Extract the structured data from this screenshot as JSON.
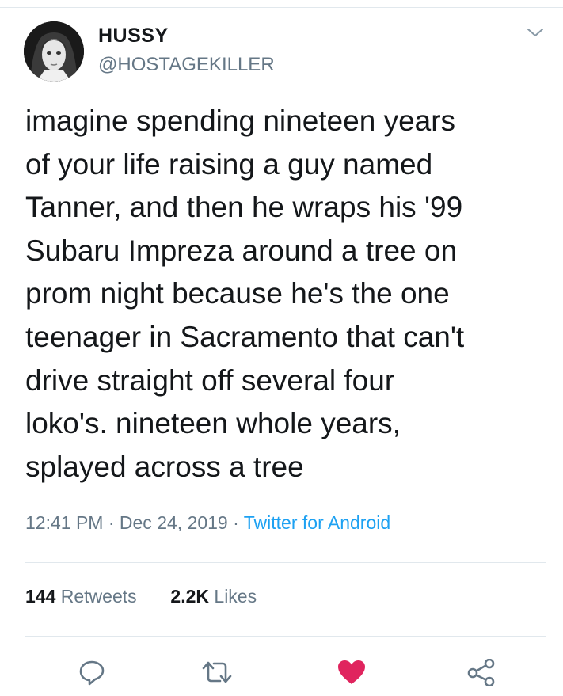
{
  "user": {
    "display_name": "HUSSY",
    "handle": "@HOSTAGEKILLER",
    "avatar_icon": "profile-photo"
  },
  "tweet": {
    "lines": [
      "imagine spending nineteen years",
      "of your life raising a guy named",
      "Tanner, and then he wraps his '99",
      "Subaru Impreza around a tree on",
      "prom night because he's the one",
      "teenager in Sacramento that can't",
      "drive straight off several four",
      "loko's. nineteen whole years,",
      "splayed across a tree"
    ],
    "time": "12:41 PM",
    "separator": "·",
    "date": "Dec 24, 2019",
    "source": "Twitter for Android"
  },
  "stats": {
    "retweets_count": "144",
    "retweets_label": "Retweets",
    "likes_count": "2.2K",
    "likes_label": "Likes"
  },
  "actions": {
    "reply_icon": "reply-icon",
    "retweet_icon": "retweet-icon",
    "like_icon": "heart-icon",
    "share_icon": "share-icon"
  },
  "colors": {
    "text": "#14171a",
    "secondary": "#657786",
    "link": "#1da1f2",
    "like": "#e0245e",
    "divider": "#e1e8ed"
  }
}
